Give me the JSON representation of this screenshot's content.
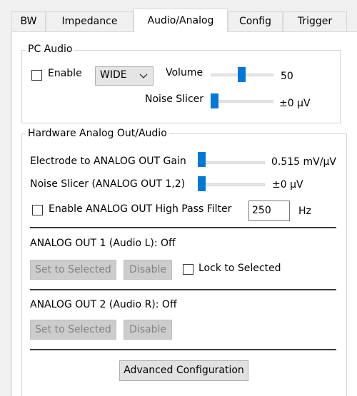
{
  "tabs": [
    {
      "label": "BW"
    },
    {
      "label": "Impedance"
    },
    {
      "label": "Audio/Analog",
      "active": true
    },
    {
      "label": "Config"
    },
    {
      "label": "Trigger"
    }
  ],
  "pc_audio": {
    "title": "PC Audio",
    "enable_label": "Enable",
    "enable_checked": false,
    "mode_selected": "WIDE",
    "volume_label": "Volume",
    "volume_value": "50",
    "noise_slicer_label": "Noise Slicer",
    "noise_slicer_value": "±0 μV"
  },
  "hardware": {
    "title": "Hardware Analog Out/Audio",
    "gain_label": "Electrode to ANALOG OUT Gain",
    "gain_value": "0.515 mV/μV",
    "noise_slicer_label": "Noise Slicer (ANALOG OUT 1,2)",
    "noise_slicer_value": "±0 μV",
    "hpf_label": "Enable ANALOG OUT High Pass Filter",
    "hpf_checked": false,
    "hpf_value": "250",
    "hpf_unit": "Hz",
    "out1_label": "ANALOG OUT 1 (Audio L):  Off",
    "out2_label": "ANALOG OUT 2 (Audio R):  Off",
    "set_selected_label": "Set to Selected",
    "disable_label": "Disable",
    "lock_label": "Lock to Selected",
    "lock_checked": false,
    "advanced_label": "Advanced Configuration"
  },
  "colors": {
    "accent": "#0078d7",
    "disabled_button": "#cccccc",
    "disabled_text": "#838383"
  }
}
